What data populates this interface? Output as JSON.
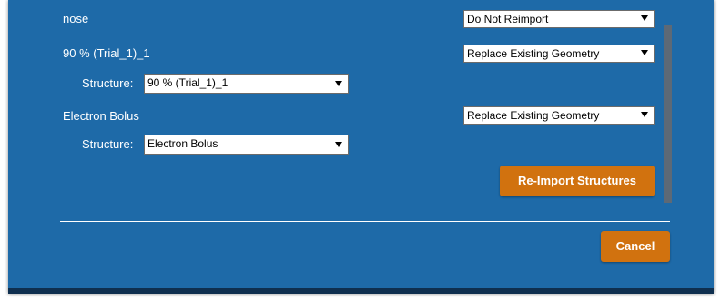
{
  "rows": [
    {
      "name": "nose",
      "action": "Do Not Reimport"
    },
    {
      "name": "90 % (Trial_1)_1",
      "action": "Replace Existing Geometry",
      "structure_label": "Structure:",
      "structure_value": "90 % (Trial_1)_1"
    },
    {
      "name": "Electron Bolus",
      "action": "Replace Existing Geometry",
      "structure_label": "Structure:",
      "structure_value": "Electron Bolus"
    }
  ],
  "buttons": {
    "reimport": "Re-Import Structures",
    "cancel": "Cancel"
  },
  "colors": {
    "dialog_background": "#1e6aa8",
    "button": "#d1720f",
    "scrollbar": "#5d6976"
  }
}
